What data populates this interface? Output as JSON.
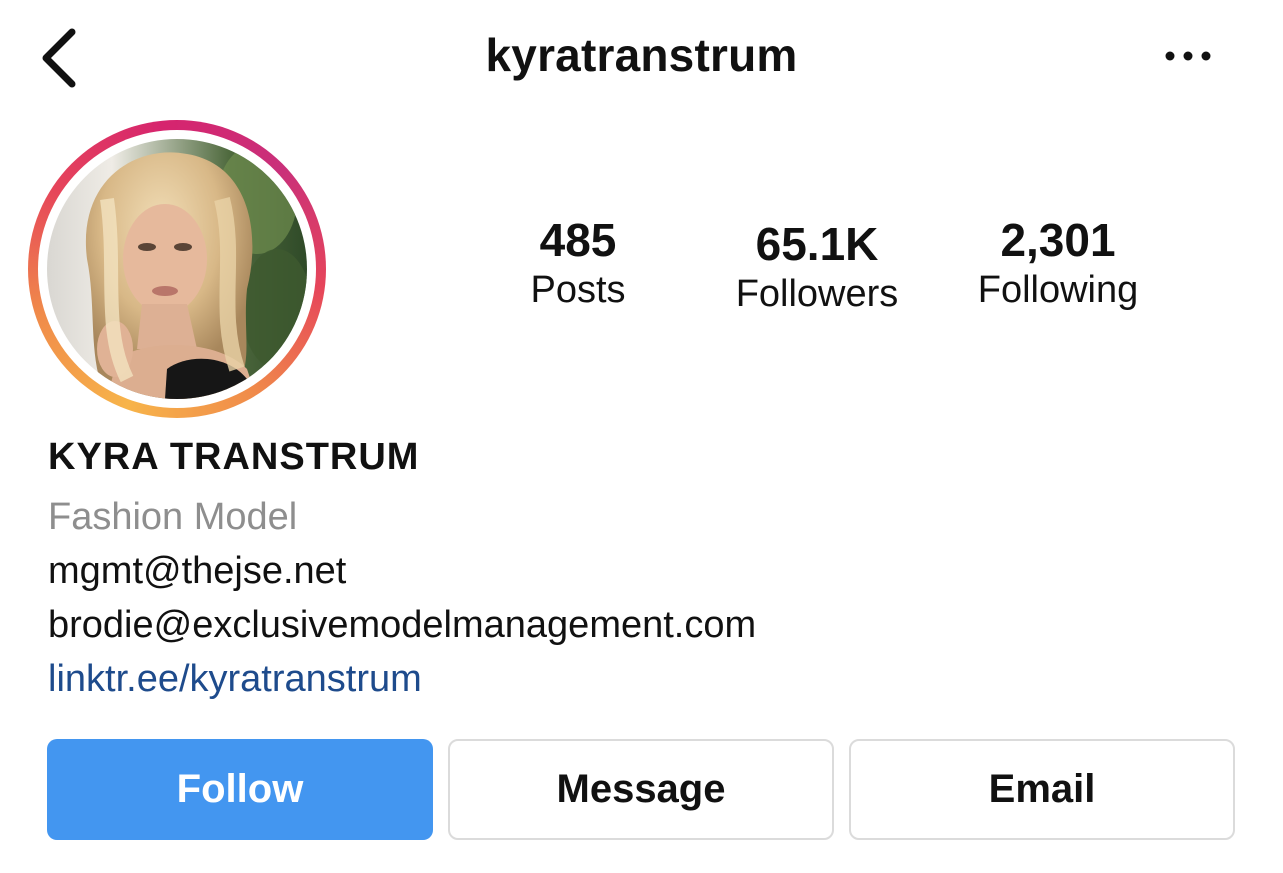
{
  "header": {
    "username": "kyratranstrum",
    "back_icon": "chevron-left-icon",
    "more_icon": "more-horizontal-icon"
  },
  "profile": {
    "avatar_icon": "profile-photo",
    "story_ring_colors": [
      "#f7b44a",
      "#e6455a",
      "#d6246e"
    ]
  },
  "stats": {
    "posts": {
      "value": "485",
      "label": "Posts"
    },
    "followers": {
      "value": "65.1K",
      "label": "Followers"
    },
    "following": {
      "value": "2,301",
      "label": "Following"
    }
  },
  "bio": {
    "name": "KYRA TRANSTRUM",
    "category": "Fashion Model",
    "email_1": "mgmt@thejse.net",
    "email_2": "brodie@exclusivemodelmanagement.com",
    "link": "linktr.ee/kyratranstrum"
  },
  "actions": {
    "follow": "Follow",
    "message": "Message",
    "email": "Email"
  },
  "colors": {
    "follow_button": "#4396f0",
    "link": "#1e4b8c",
    "category": "#8e8e8e"
  }
}
